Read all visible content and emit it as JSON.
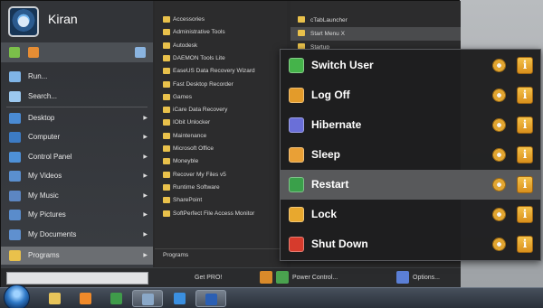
{
  "user": {
    "name": "Kiran"
  },
  "left_menu": {
    "items": [
      {
        "label": "Run...",
        "icon": "run-icon",
        "color": "#7fb4e6",
        "arrow": false
      },
      {
        "label": "Search...",
        "icon": "search-icon",
        "color": "#9cc8ef",
        "arrow": false
      },
      {
        "label": "Desktop",
        "icon": "desktop-icon",
        "color": "#4a8bd4",
        "arrow": true
      },
      {
        "label": "Computer",
        "icon": "computer-icon",
        "color": "#3c7bc4",
        "arrow": true
      },
      {
        "label": "Control Panel",
        "icon": "control-panel-icon",
        "color": "#4e91d8",
        "arrow": true
      },
      {
        "label": "My Videos",
        "icon": "videos-icon",
        "color": "#5a8fcf",
        "arrow": true
      },
      {
        "label": "My Music",
        "icon": "music-icon",
        "color": "#5c86c2",
        "arrow": true
      },
      {
        "label": "My Pictures",
        "icon": "pictures-icon",
        "color": "#5a8ccb",
        "arrow": true
      },
      {
        "label": "My Documents",
        "icon": "documents-icon",
        "color": "#5f90cf",
        "arrow": true
      },
      {
        "label": "Programs",
        "icon": "programs-icon",
        "color": "#e9c14b",
        "arrow": true
      }
    ]
  },
  "programs": {
    "items": [
      "Accessories",
      "Administrative Tools",
      "Autodesk",
      "DAEMON Tools Lite",
      "EaseUS Data Recovery Wizard",
      "Fast Desktop Recorder",
      "Games",
      "iCare Data Recovery",
      "IObit Unlocker",
      "Maintenance",
      "Microsoft Office",
      "Moneyble",
      "Recover My Files v5",
      "Runtime Software",
      "SharePoint",
      "SoftPerfect File Access Monitor"
    ],
    "footer": "Programs"
  },
  "programs_sub": {
    "items": [
      "cTabLauncher",
      "Start Menu X",
      "Startup"
    ]
  },
  "bottom_bar": {
    "search_placeholder": "",
    "get_pro": "Get PRO!",
    "power_control": "Power Control...",
    "options": "Options..."
  },
  "power_menu": {
    "items": [
      {
        "label": "Switch User",
        "icon": "switch-user-icon",
        "color": "#45b34a",
        "hover": false
      },
      {
        "label": "Log Off",
        "icon": "log-off-icon",
        "color": "#e39b2a",
        "hover": false
      },
      {
        "label": "Hibernate",
        "icon": "hibernate-icon",
        "color": "#6a6fd8",
        "hover": false
      },
      {
        "label": "Sleep",
        "icon": "sleep-icon",
        "color": "#e9a036",
        "hover": false
      },
      {
        "label": "Restart",
        "icon": "restart-icon",
        "color": "#3aa04a",
        "hover": true
      },
      {
        "label": "Lock",
        "icon": "lock-icon",
        "color": "#e8a82e",
        "hover": false
      },
      {
        "label": "Shut Down",
        "icon": "shut-down-icon",
        "color": "#d63b2c",
        "hover": false
      }
    ],
    "info_glyph": "i"
  },
  "taskbar": {
    "items": [
      {
        "name": "explorer-icon",
        "color": "#e7c45a",
        "open": false
      },
      {
        "name": "media-player-icon",
        "color": "#f08a2a",
        "open": false
      },
      {
        "name": "chrome-icon",
        "color": "#3f9b4a",
        "open": false
      },
      {
        "name": "control-panel-icon",
        "color": "#8aa8c8",
        "open": true
      },
      {
        "name": "internet-explorer-icon",
        "color": "#3a8fe0",
        "open": false
      },
      {
        "name": "word-icon",
        "color": "#2b5fb3",
        "open": true
      }
    ]
  }
}
